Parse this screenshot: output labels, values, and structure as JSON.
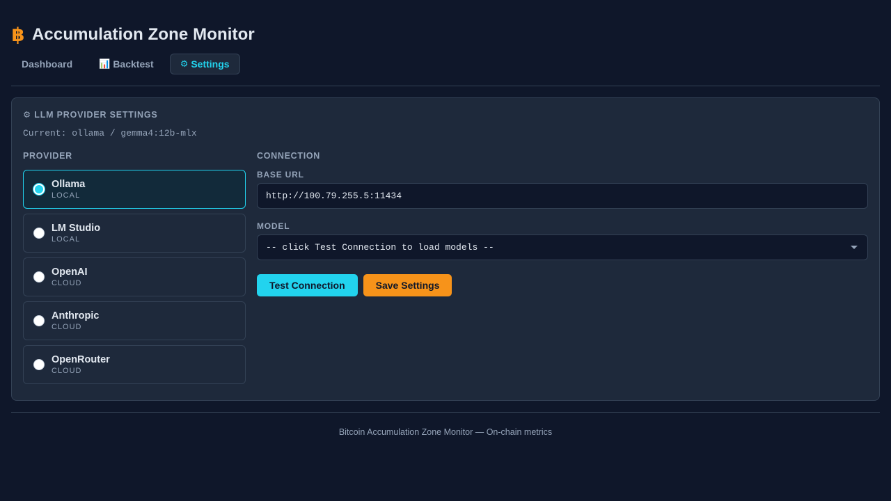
{
  "app": {
    "title": "Accumulation Zone Monitor",
    "logo_icon": "bitcoin-icon",
    "logo_glyph": "฿"
  },
  "tabs": [
    {
      "label": "Dashboard",
      "icon": "",
      "active": false
    },
    {
      "label": "Backtest",
      "icon": "📊",
      "active": false
    },
    {
      "label": "Settings",
      "icon": "⚙",
      "active": true
    }
  ],
  "settings": {
    "title": "⚙ LLM PROVIDER SETTINGS",
    "current": "Current: ollama / gemma4:12b-mlx",
    "provider_label": "PROVIDER",
    "providers": [
      {
        "name": "Ollama",
        "type": "LOCAL",
        "selected": true
      },
      {
        "name": "LM Studio",
        "type": "LOCAL",
        "selected": false
      },
      {
        "name": "OpenAI",
        "type": "CLOUD",
        "selected": false
      },
      {
        "name": "Anthropic",
        "type": "CLOUD",
        "selected": false
      },
      {
        "name": "OpenRouter",
        "type": "CLOUD",
        "selected": false
      }
    ],
    "connection_label": "CONNECTION",
    "base_url_label": "BASE URL",
    "base_url_value": "http://100.79.255.5:11434",
    "model_label": "MODEL",
    "model_value": "-- click Test Connection to load models --",
    "test_button": "Test Connection",
    "save_button": "Save Settings"
  },
  "footer": {
    "text": "Bitcoin Accumulation Zone Monitor — On-chain metrics"
  },
  "colors": {
    "background": "#0f172a",
    "panel": "#1e293b",
    "accent": "#22d3ee",
    "bitcoin": "#f7931a"
  }
}
